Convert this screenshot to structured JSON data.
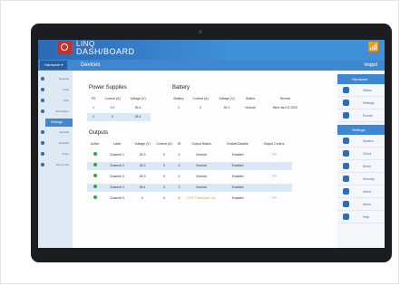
{
  "brand": {
    "line1": "LINQ",
    "line2": "DASH/BOARD"
  },
  "header": {
    "selector": "Hardware",
    "section": "Devices",
    "right_label": "linqlpd"
  },
  "left_sidebar": {
    "items": [
      {
        "label": "Network"
      },
      {
        "label": "Links"
      },
      {
        "label": "Joint"
      },
      {
        "label": "Information"
      }
    ],
    "settings_header": "Settings",
    "settings_items": [
      {
        "label": "General"
      },
      {
        "label": "Network"
      },
      {
        "label": "Users"
      },
      {
        "label": "About Linq"
      }
    ]
  },
  "power_supplies": {
    "title": "Power Supplies",
    "columns": [
      "PS",
      "Current (A)",
      "Voltage (V)"
    ],
    "rows": [
      [
        "1",
        "0.2",
        "26.3"
      ],
      [
        "2",
        "0",
        "26.4"
      ]
    ]
  },
  "battery": {
    "title": "Battery",
    "columns": [
      "Battery",
      "Current (A)",
      "Voltage (V)",
      "Status",
      "Service"
    ],
    "rows": [
      [
        "1",
        "0",
        "26.1",
        "Normal",
        "Wed Jan 01 2020"
      ]
    ]
  },
  "outputs": {
    "title": "Outputs",
    "columns": [
      "Active",
      "Label",
      "Voltage (V)",
      "Current (A)",
      "W",
      "Output Status",
      "Enable/Disable",
      "Output Control"
    ],
    "rows": [
      [
        "",
        "Channel 1",
        "26.3",
        "0",
        "0",
        "Normal",
        "Enabled",
        ""
      ],
      [
        "",
        "Channel 2",
        "26.3",
        "0",
        "0",
        "Normal",
        "Enabled",
        ""
      ],
      [
        "",
        "Channel 3",
        "26.3",
        "0",
        "0",
        "Normal",
        "Enabled",
        ""
      ],
      [
        "",
        "Channel 4",
        "26.4",
        "3",
        "3",
        "Normal",
        "Enabled",
        ""
      ],
      [
        "",
        "Channel 5",
        "0",
        "0",
        "0",
        "OUT Threshold Low",
        "Enabled",
        ""
      ]
    ]
  },
  "right_sidebar": {
    "hardware_header": "Hardware",
    "hardware_items": [
      {
        "label": "Status"
      },
      {
        "label": "Settings"
      },
      {
        "label": "Events"
      }
    ],
    "settings_header": "Settings",
    "settings_items": [
      {
        "label": "System"
      },
      {
        "label": "Cloud"
      },
      {
        "label": "Email"
      },
      {
        "label": "Security"
      },
      {
        "label": "Users"
      },
      {
        "label": "Alerts"
      },
      {
        "label": "Help"
      }
    ]
  },
  "colors": {
    "accent": "#3f87cf",
    "brand_red": "#c8302a",
    "ok_green": "#2eaa3d",
    "warn_orange": "#e39b16"
  }
}
